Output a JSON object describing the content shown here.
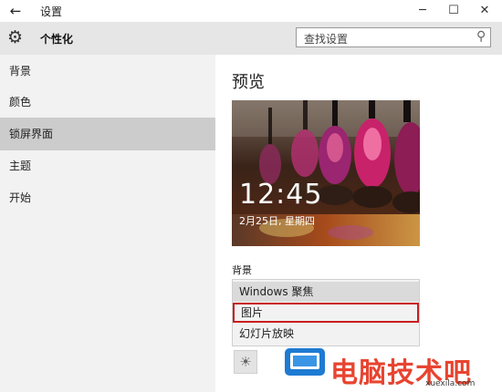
{
  "window": {
    "title": "设置"
  },
  "header": {
    "title": "个性化"
  },
  "search": {
    "placeholder": "查找设置"
  },
  "sidebar": {
    "items": [
      {
        "label": "背景"
      },
      {
        "label": "颜色"
      },
      {
        "label": "锁屏界面"
      },
      {
        "label": "主题"
      },
      {
        "label": "开始"
      }
    ],
    "selected_label": "锁屏界面"
  },
  "main": {
    "preview_title": "预览",
    "preview_time": "12:45",
    "preview_date": "2月25日, 星期四",
    "background_label": "背景",
    "dropdown_options": [
      {
        "label": "Windows 聚焦"
      },
      {
        "label": "图片"
      },
      {
        "label": "幻灯片放映"
      }
    ],
    "dropdown_selected": "Windows 聚焦",
    "dropdown_highlighted": "图片"
  },
  "watermark": {
    "text": "电脑技术吧",
    "url": "xuexila.com"
  },
  "colors": {
    "accent_red": "#c81e1e",
    "sidebar_selected": "#cccccc",
    "watermark_red": "#e84430",
    "watermark_blue": "#1e7bd2"
  }
}
